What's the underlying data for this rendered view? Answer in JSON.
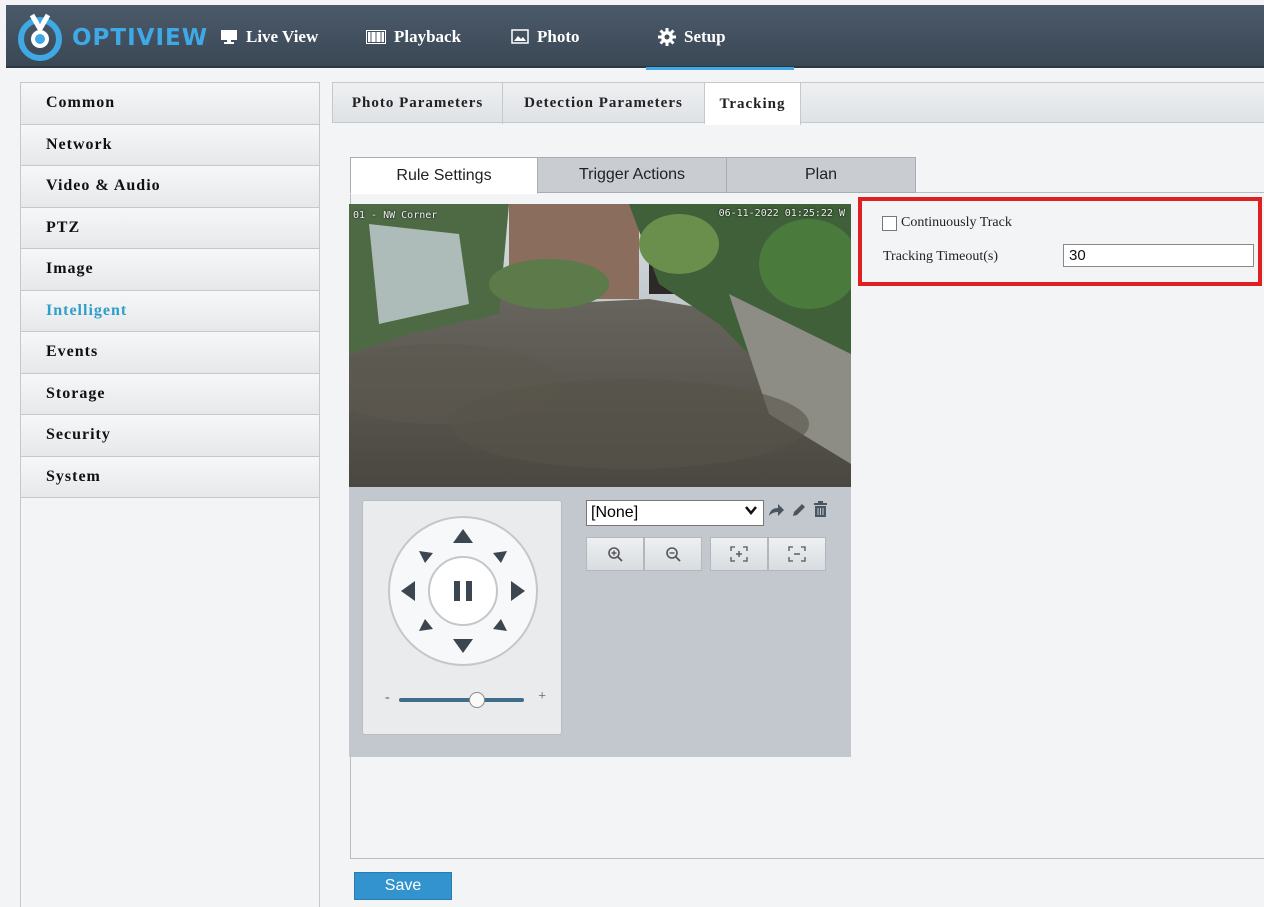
{
  "brand": {
    "name": "OPTIVIEW",
    "accent": "#3fa9e6"
  },
  "nav": {
    "live_view": "Live View",
    "playback": "Playback",
    "photo": "Photo",
    "setup": "Setup"
  },
  "sidebar": {
    "items": [
      {
        "label": "Common"
      },
      {
        "label": "Network"
      },
      {
        "label": "Video & Audio"
      },
      {
        "label": "PTZ"
      },
      {
        "label": "Image"
      },
      {
        "label": "Intelligent",
        "active": true
      },
      {
        "label": "Events"
      },
      {
        "label": "Storage"
      },
      {
        "label": "Security"
      },
      {
        "label": "System"
      }
    ]
  },
  "subtabs": [
    "Photo Parameters",
    "Detection Parameters",
    "Tracking"
  ],
  "rule_tabs": [
    "Rule Settings",
    "Trigger Actions",
    "Plan"
  ],
  "video": {
    "osd_left": "01 - NW Corner",
    "osd_right": "06-11-2022 01:25:22 W"
  },
  "ptz": {
    "preset_value": "[None]",
    "speed_min_label": "-",
    "speed_max_label": "+",
    "speed_level": 0.62
  },
  "tracking": {
    "continuously_track_label": "Continuously Track",
    "continuously_track_checked": false,
    "timeout_label": "Tracking Timeout(s)",
    "timeout_value": "30"
  },
  "save_label": "Save"
}
